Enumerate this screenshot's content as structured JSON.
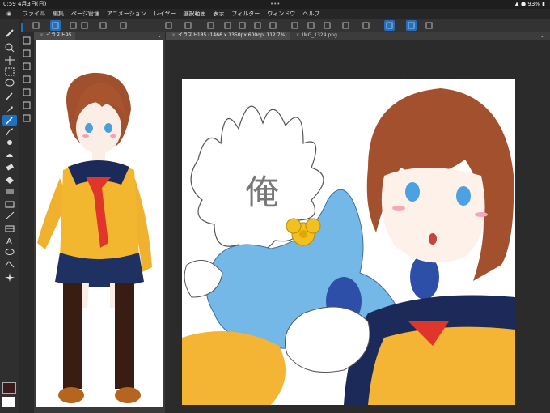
{
  "status": {
    "time": "0:59",
    "date": "4月3日(日)",
    "dots": "•••",
    "battery": "93%"
  },
  "menu": [
    "ファイル",
    "編集",
    "ページ管理",
    "アニメーション",
    "レイヤー",
    "選択範囲",
    "表示",
    "フィルター",
    "ウィンドウ",
    "ヘルプ"
  ],
  "tabs": {
    "left": "イラスト95",
    "main_active": "イラスト185 (1466 x 1350px 600dpi 112.7%)",
    "main_other": "IMG_1324.png"
  },
  "canvas_text": "俺",
  "colors": {
    "accent": "#1f6fc2",
    "main_color": "#3a1a1a"
  },
  "icons": {
    "toolbox": [
      "brush-icon",
      "magnify-icon",
      "move-icon",
      "select-icon",
      "lasso-icon",
      "eyedropper-icon",
      "pen-icon",
      "pencil-icon",
      "brush-alt-icon",
      "airbrush-icon",
      "blend-icon",
      "eraser-icon",
      "fill-icon",
      "gradient-icon",
      "figure-icon",
      "ruler-icon",
      "frame-icon",
      "text-icon",
      "balloon-icon",
      "correct-icon",
      "sparkle-icon"
    ]
  }
}
